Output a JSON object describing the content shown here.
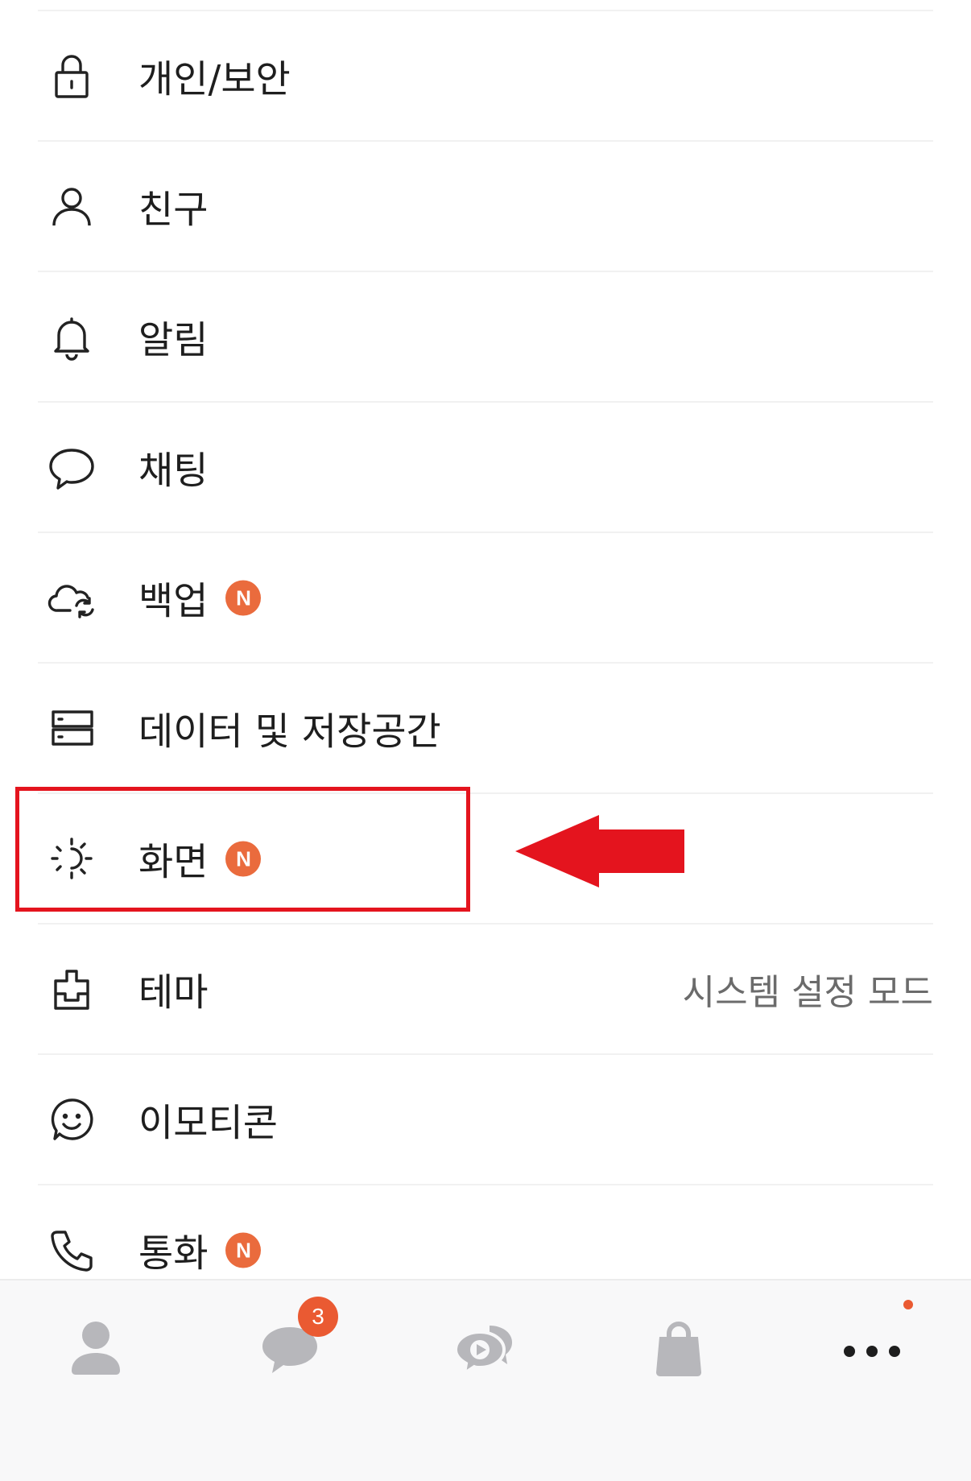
{
  "settings": {
    "items": [
      {
        "id": "privacy",
        "label": "개인/보안",
        "icon": "lock-icon"
      },
      {
        "id": "friends",
        "label": "친구",
        "icon": "person-icon"
      },
      {
        "id": "notifications",
        "label": "알림",
        "icon": "bell-icon"
      },
      {
        "id": "chatting",
        "label": "채팅",
        "icon": "chat-bubble-icon"
      },
      {
        "id": "backup",
        "label": "백업",
        "icon": "cloud-sync-icon",
        "badge": "N"
      },
      {
        "id": "storage",
        "label": "데이터 및 저장공간",
        "icon": "storage-icon"
      },
      {
        "id": "display",
        "label": "화면",
        "icon": "sun-icon",
        "badge": "N"
      },
      {
        "id": "theme",
        "label": "테마",
        "icon": "brush-icon",
        "value": "시스템 설정 모드"
      },
      {
        "id": "emoticons",
        "label": "이모티콘",
        "icon": "smiley-icon"
      },
      {
        "id": "calls",
        "label": "통화",
        "icon": "phone-icon",
        "badge": "N"
      }
    ]
  },
  "tabbar": {
    "tabs": [
      {
        "id": "friends",
        "icon": "person-filled-icon"
      },
      {
        "id": "chats",
        "icon": "chat-filled-icon",
        "badge": "3"
      },
      {
        "id": "openchat",
        "icon": "openchat-play-icon"
      },
      {
        "id": "shopping",
        "icon": "shopping-bag-icon"
      },
      {
        "id": "more",
        "icon": "more-dots-icon",
        "has_dot": true
      }
    ]
  },
  "colors": {
    "badge": "#ea6b3d",
    "highlight": "#e4141e",
    "tab_icon": "#b7b7bb"
  }
}
